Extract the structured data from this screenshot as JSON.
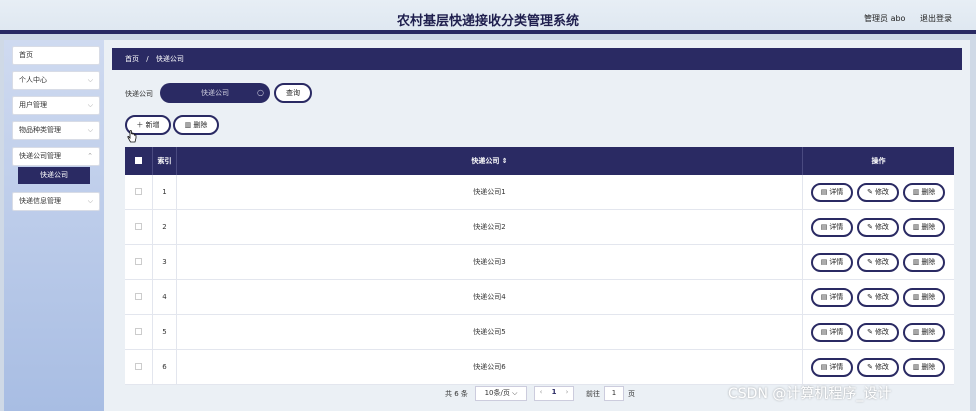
{
  "header": {
    "title": "农村基层快递接收分类管理系统",
    "user": "管理员 abo",
    "logout": "退出登录"
  },
  "sidebar": {
    "items": [
      {
        "label": "首页"
      },
      {
        "label": "个人中心"
      },
      {
        "label": "用户管理"
      },
      {
        "label": "物品种类管理"
      },
      {
        "label": "快递公司管理"
      },
      {
        "label": "快递信息管理"
      }
    ],
    "active_sub": "快递公司"
  },
  "breadcrumb": {
    "home": "首页",
    "separator": "/",
    "current": "快递公司"
  },
  "search": {
    "label": "快递公司",
    "placeholder": "快递公司",
    "query_button": "查询"
  },
  "toolbar": {
    "add_label": "新增",
    "delete_label": "删除"
  },
  "table": {
    "headers": {
      "index": "索引",
      "name": "快递公司 ⇕",
      "actions": "操作"
    },
    "rows": [
      {
        "index": "1",
        "name": "快递公司1"
      },
      {
        "index": "2",
        "name": "快递公司2"
      },
      {
        "index": "3",
        "name": "快递公司3"
      },
      {
        "index": "4",
        "name": "快递公司4"
      },
      {
        "index": "5",
        "name": "快递公司5"
      },
      {
        "index": "6",
        "name": "快递公司6"
      }
    ],
    "row_actions": {
      "detail": "详情",
      "edit": "修改",
      "delete": "删除"
    }
  },
  "pagination": {
    "total": "共 6 条",
    "page_size": "10条/页",
    "current_page": "1",
    "goto_label": "前往",
    "goto_value": "1",
    "page_unit": "页"
  },
  "watermark": "CSDN @计算机程序_设计",
  "colors": {
    "primary": "#2a2a63",
    "background": "#cfd9e6"
  }
}
